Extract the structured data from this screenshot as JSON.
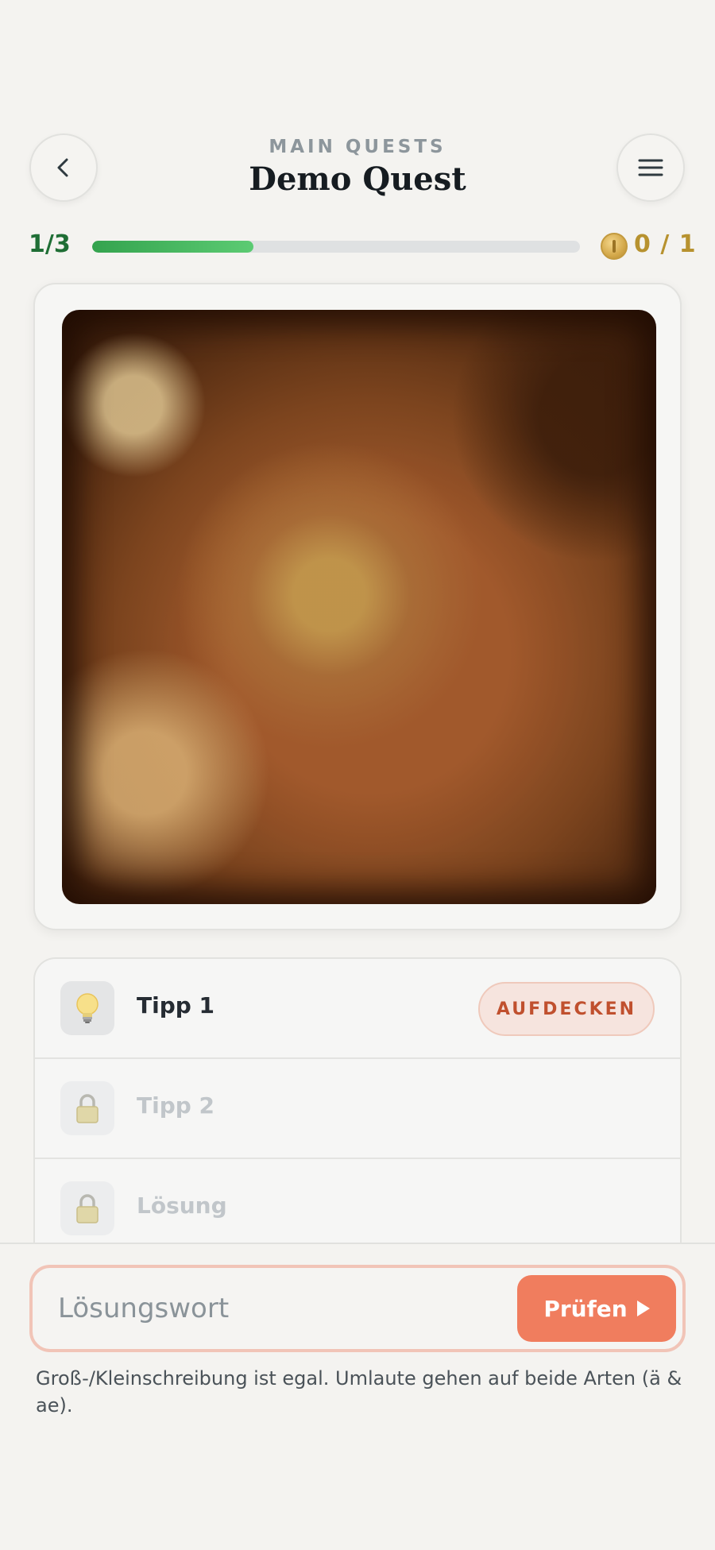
{
  "header": {
    "category": "MAIN QUESTS",
    "title": "Demo Quest",
    "back_icon": "chevron-left-icon",
    "menu_icon": "hamburger-menu-icon"
  },
  "progress": {
    "step_label": "1/3",
    "current_step": 1,
    "total_steps": 3,
    "bar_fraction": 0.33,
    "coin_label": "0 / 1",
    "coins_collected": 0,
    "coins_total": 1,
    "accent_color": "#3cae56"
  },
  "quest_image": {
    "description_icon": "blurred-quest-image"
  },
  "hints": [
    {
      "label": "Tipp 1",
      "icon": "lightbulb-icon",
      "locked": false,
      "action_label": "AUFDECKEN"
    },
    {
      "label": "Tipp 2",
      "icon": "lock-icon",
      "locked": true
    },
    {
      "label": "Lösung",
      "icon": "lock-icon",
      "locked": true
    }
  ],
  "answer": {
    "placeholder": "Lösungswort",
    "value": "",
    "submit_label": "Prüfen",
    "submit_color": "#f07d5e",
    "helper_text": "Groß-/Kleinschreibung ist egal. Umlaute gehen auf beide Arten (ä & ae)."
  }
}
